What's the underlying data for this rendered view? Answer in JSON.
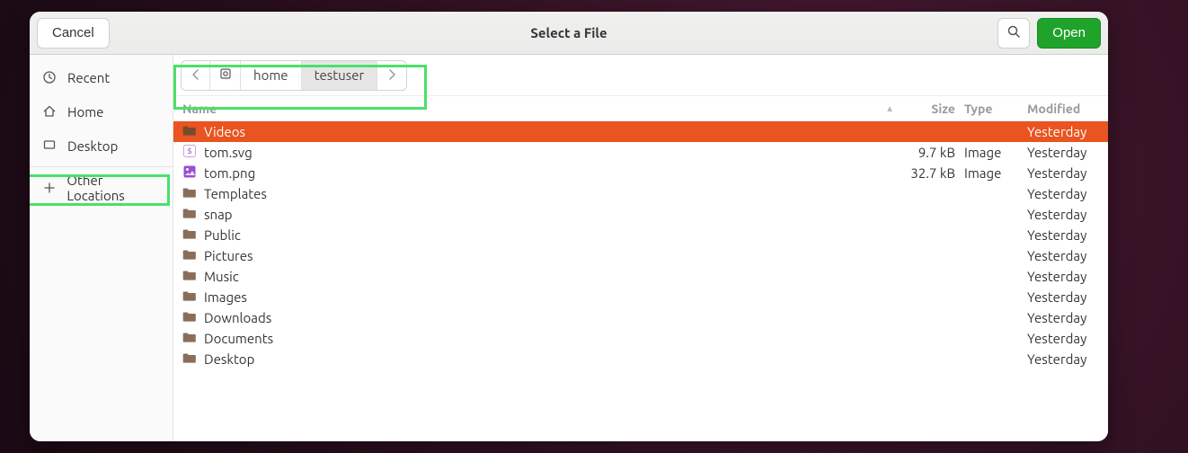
{
  "header": {
    "cancel_label": "Cancel",
    "title": "Select a File",
    "open_label": "Open"
  },
  "sidebar": {
    "items": [
      {
        "key": "recent",
        "label": "Recent"
      },
      {
        "key": "home",
        "label": "Home"
      },
      {
        "key": "desktop",
        "label": "Desktop"
      }
    ],
    "other_label": "Other Locations"
  },
  "pathbar": {
    "segments": [
      {
        "key": "home",
        "label": "home",
        "active": false
      },
      {
        "key": "testuser",
        "label": "testuser",
        "active": true
      }
    ]
  },
  "columns": {
    "name": "Name",
    "size": "Size",
    "type": "Type",
    "modified": "Modified"
  },
  "files": [
    {
      "icon": "folder",
      "name": "Videos",
      "size": "",
      "type": "",
      "modified": "Yesterday",
      "selected": true
    },
    {
      "icon": "svg",
      "name": "tom.svg",
      "size": "9.7 kB",
      "type": "Image",
      "modified": "Yesterday",
      "selected": false
    },
    {
      "icon": "png",
      "name": "tom.png",
      "size": "32.7 kB",
      "type": "Image",
      "modified": "Yesterday",
      "selected": false
    },
    {
      "icon": "folder",
      "name": "Templates",
      "size": "",
      "type": "",
      "modified": "Yesterday",
      "selected": false
    },
    {
      "icon": "folder",
      "name": "snap",
      "size": "",
      "type": "",
      "modified": "Yesterday",
      "selected": false
    },
    {
      "icon": "folder",
      "name": "Public",
      "size": "",
      "type": "",
      "modified": "Yesterday",
      "selected": false
    },
    {
      "icon": "folder",
      "name": "Pictures",
      "size": "",
      "type": "",
      "modified": "Yesterday",
      "selected": false
    },
    {
      "icon": "folder",
      "name": "Music",
      "size": "",
      "type": "",
      "modified": "Yesterday",
      "selected": false
    },
    {
      "icon": "folder",
      "name": "Images",
      "size": "",
      "type": "",
      "modified": "Yesterday",
      "selected": false
    },
    {
      "icon": "folder",
      "name": "Downloads",
      "size": "",
      "type": "",
      "modified": "Yesterday",
      "selected": false
    },
    {
      "icon": "folder",
      "name": "Documents",
      "size": "",
      "type": "",
      "modified": "Yesterday",
      "selected": false
    },
    {
      "icon": "folder",
      "name": "Desktop",
      "size": "",
      "type": "",
      "modified": "Yesterday",
      "selected": false
    }
  ],
  "colors": {
    "selection": "#e95420",
    "primary_button": "#1fa32b",
    "highlight_box": "#4be06a"
  }
}
